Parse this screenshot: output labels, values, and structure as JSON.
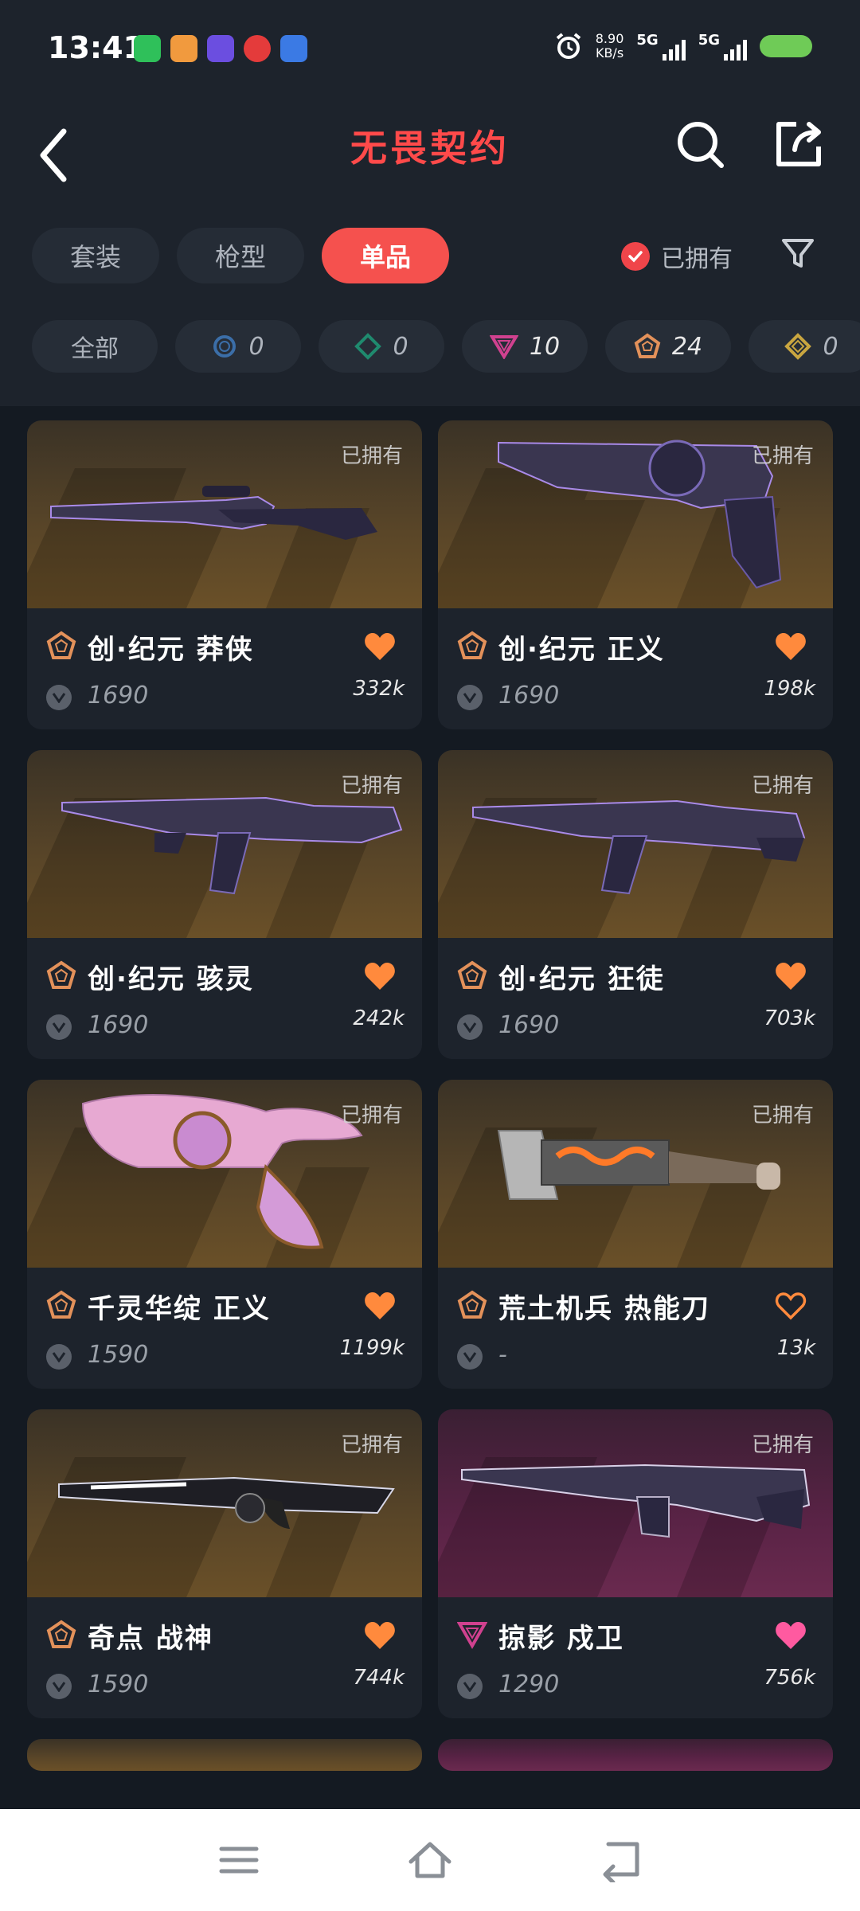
{
  "status_bar": {
    "time": "13:41",
    "net_speed_value": "8.90",
    "net_speed_unit": "KB/s",
    "signal_1": "5G",
    "signal_2": "5G",
    "app_icons": [
      "wechat-icon",
      "chat-app-icon",
      "infinity-app-icon",
      "red-app-icon",
      "blue-app-icon"
    ]
  },
  "header": {
    "title": "无畏契约",
    "back_icon": "chevron-left-icon",
    "search_icon": "search-icon",
    "share_icon": "share-icon"
  },
  "tabs": [
    {
      "label": "套装",
      "active": false
    },
    {
      "label": "枪型",
      "active": false
    },
    {
      "label": "单品",
      "active": true
    }
  ],
  "owned_filter": {
    "label": "已拥有",
    "checked": true
  },
  "rarity_chips": [
    {
      "label": "全部"
    },
    {
      "icon": "circle-tier-icon",
      "count": "0",
      "color": "#3b6ea8"
    },
    {
      "icon": "diamond-tier-icon",
      "count": "0",
      "color": "#1f8a6e"
    },
    {
      "icon": "triangle-tier-icon",
      "count": "10",
      "color": "#d0418f"
    },
    {
      "icon": "pentagon-tier-icon",
      "count": "24",
      "color": "#e3915a"
    },
    {
      "icon": "rhombus-tier-icon",
      "count": "0",
      "color": "#c9a640"
    }
  ],
  "items": [
    {
      "name": "创·纪元 莽侠",
      "price": "1690",
      "likes": "332k",
      "tier": "pentagon",
      "favorited": true,
      "owned_label": "已拥有"
    },
    {
      "name": "创·纪元 正义",
      "price": "1690",
      "likes": "198k",
      "tier": "pentagon",
      "favorited": true,
      "owned_label": "已拥有"
    },
    {
      "name": "创·纪元 骇灵",
      "price": "1690",
      "likes": "242k",
      "tier": "pentagon",
      "favorited": true,
      "owned_label": "已拥有"
    },
    {
      "name": "创·纪元 狂徒",
      "price": "1690",
      "likes": "703k",
      "tier": "pentagon",
      "favorited": true,
      "owned_label": "已拥有"
    },
    {
      "name": "千灵华绽 正义",
      "price": "1590",
      "likes": "1199k",
      "tier": "pentagon",
      "favorited": true,
      "owned_label": "已拥有"
    },
    {
      "name": "荒土机兵 热能刀",
      "price": "-",
      "likes": "13k",
      "tier": "pentagon",
      "favorited": false,
      "owned_label": "已拥有"
    },
    {
      "name": "奇点 战神",
      "price": "1590",
      "likes": "744k",
      "tier": "pentagon",
      "favorited": true,
      "owned_label": "已拥有"
    },
    {
      "name": "掠影 戍卫",
      "price": "1290",
      "likes": "756k",
      "tier": "triangle",
      "favorited": true,
      "owned_label": "已拥有"
    }
  ],
  "colors": {
    "accent": "#f5514e",
    "heart_orange": "#ff8a3d",
    "heart_pink": "#ff5aa0",
    "tier_orange": "#e3915a",
    "tier_pink": "#d0418f"
  }
}
